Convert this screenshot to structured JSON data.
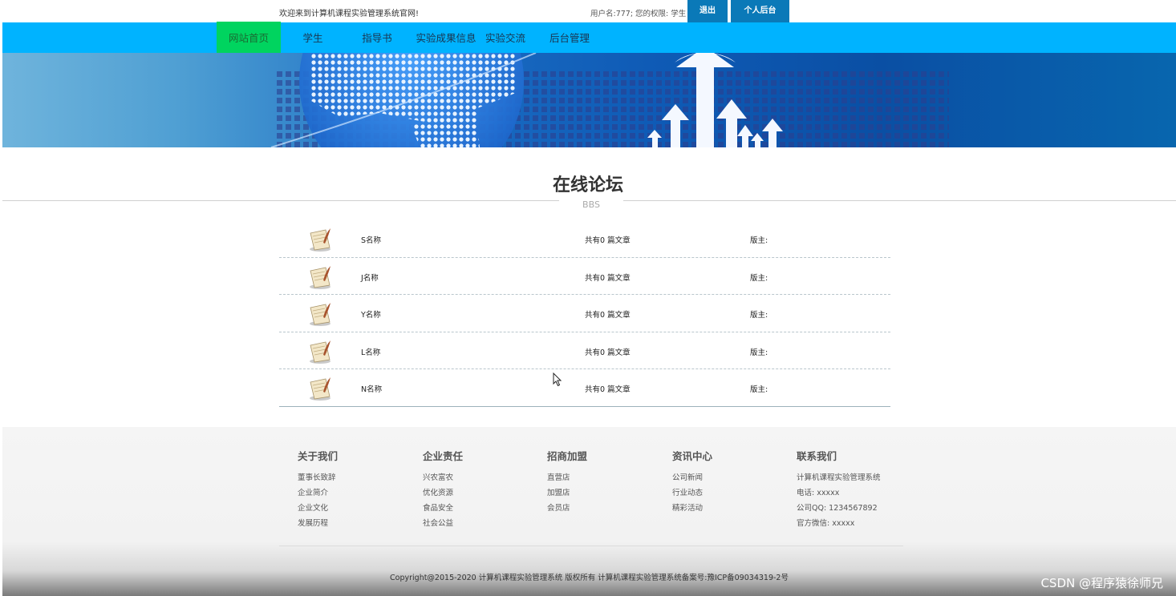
{
  "topbar": {
    "welcome": "欢迎来到计算机课程实验管理系统官网!",
    "user_info": "用户名:777;  您的权限: 学生",
    "logout_label": "退出",
    "admin_label": "个人后台"
  },
  "nav": {
    "items": [
      "网站首页",
      "学生",
      "指导书",
      "实验成果信息",
      "实验交流",
      "后台管理"
    ],
    "active_index": 0
  },
  "section": {
    "title": "在线论坛",
    "subtitle": "BBS"
  },
  "forum": {
    "rows": [
      {
        "name": "S名称",
        "count": "共有0 篇文章",
        "moderator": "版主:"
      },
      {
        "name": "J名称",
        "count": "共有0 篇文章",
        "moderator": "版主:"
      },
      {
        "name": "Y名称",
        "count": "共有0 篇文章",
        "moderator": "版主:"
      },
      {
        "name": "L名称",
        "count": "共有0 篇文章",
        "moderator": "版主:"
      },
      {
        "name": "N名称",
        "count": "共有0 篇文章",
        "moderator": "版主:"
      }
    ]
  },
  "footer": {
    "columns": [
      {
        "heading": "关于我们",
        "items": [
          "董事长致辞",
          "企业简介",
          "企业文化",
          "发展历程"
        ]
      },
      {
        "heading": "企业责任",
        "items": [
          "兴农富农",
          "优化资源",
          "食品安全",
          "社会公益"
        ]
      },
      {
        "heading": "招商加盟",
        "items": [
          "直营店",
          "加盟店",
          "会员店"
        ]
      },
      {
        "heading": "资讯中心",
        "items": [
          "公司新闻",
          "行业动态",
          "精彩活动"
        ]
      },
      {
        "heading": "联系我们",
        "items": [
          "计算机课程实验管理系统",
          "电话:  xxxxx",
          "公司QQ:  1234567892",
          "官方微信:  xxxxx"
        ]
      }
    ],
    "copyright": "Copyright@2015-2020 计算机课程实验管理系统 版权所有 计算机课程实验管理系统备案号:豫ICP备09034319-2号",
    "watermark": "CSDN @程序猿徐师兄"
  },
  "colors": {
    "nav_bg": "#00b3ff",
    "nav_active": "#00d45f",
    "button_bg": "#0a79b8"
  }
}
